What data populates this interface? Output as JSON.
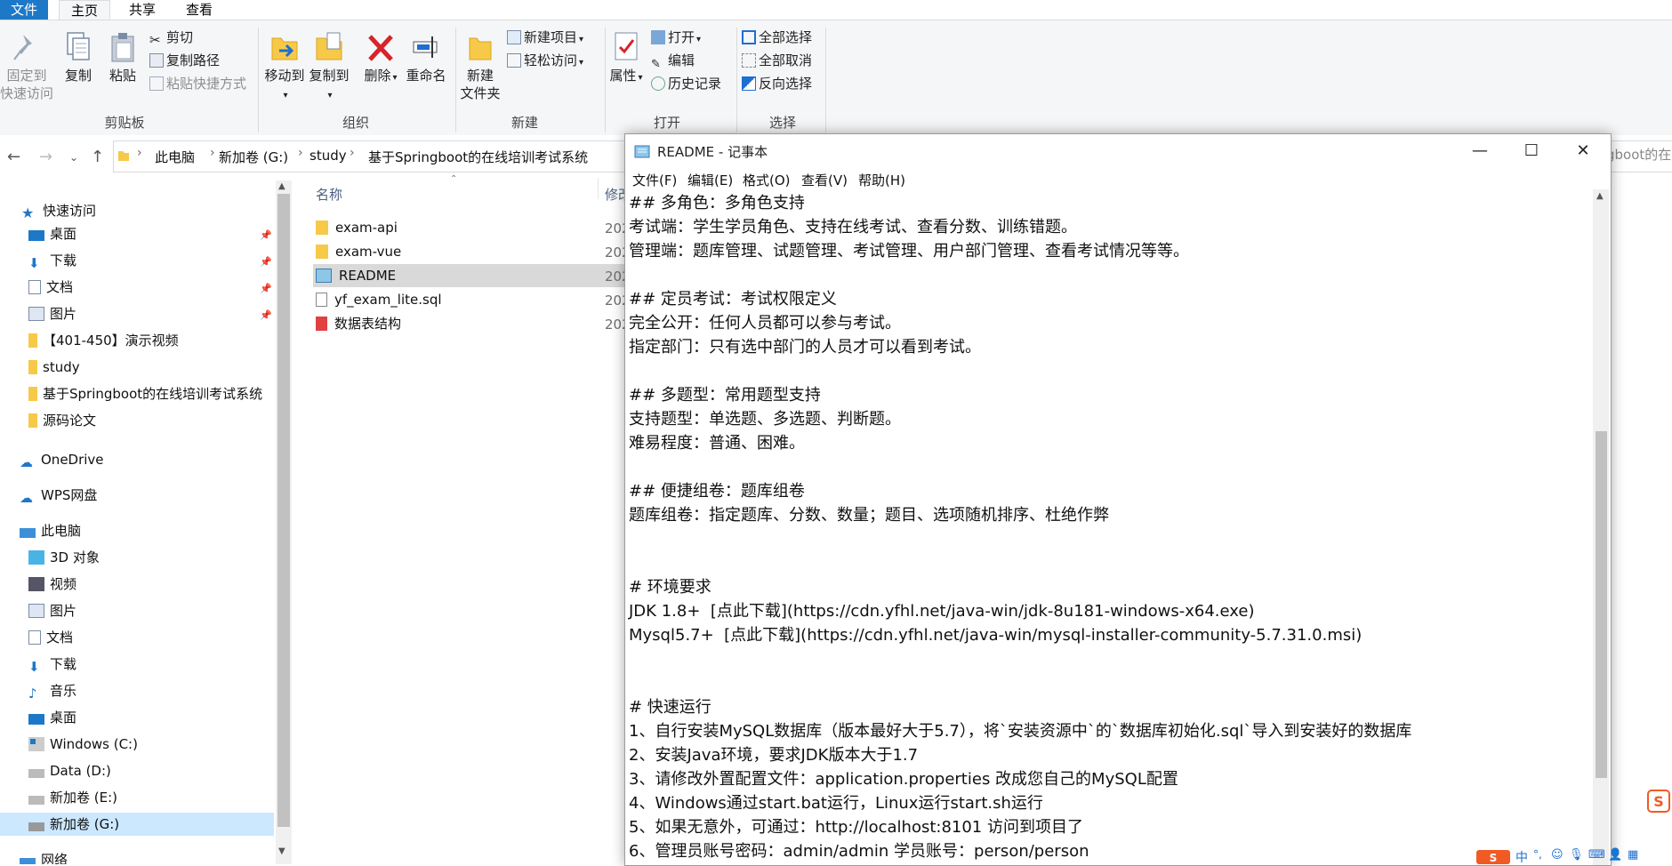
{
  "ribbon_tabs": {
    "file": "文件",
    "home": "主页",
    "share": "共享",
    "view": "查看"
  },
  "ribbon": {
    "pin_line1": "固定到",
    "pin_line2": "快速访问",
    "copy": "复制",
    "paste": "粘贴",
    "cut": "剪切",
    "copy_path": "复制路径",
    "paste_shortcut": "粘贴快捷方式",
    "group_clipboard": "剪贴板",
    "move_to": "移动到",
    "copy_to": "复制到",
    "delete": "删除",
    "rename": "重命名",
    "group_organize": "组织",
    "new_folder_line1": "新建",
    "new_folder_line2": "文件夹",
    "new_item": "新建项目",
    "easy_access": "轻松访问",
    "group_new": "新建",
    "properties": "属性",
    "open": "打开",
    "edit": "编辑",
    "history": "历史记录",
    "group_open": "打开",
    "select_all": "全部选择",
    "select_none": "全部取消",
    "invert_selection": "反向选择",
    "group_select": "选择"
  },
  "address": {
    "crumbs": [
      "此电脑",
      "新加卷 (G:)",
      "study",
      "基于Springboot的在线培训考试系统"
    ],
    "right_fragment": "gboot的在"
  },
  "nav": {
    "quick_access": "快速访问",
    "qa_items": [
      "桌面",
      "下载",
      "文档",
      "图片",
      "【401-450】演示视频",
      "study",
      "基于Springboot的在线培训考试系统",
      "源码论文"
    ],
    "onedrive": "OneDrive",
    "wps": "WPS网盘",
    "this_pc": "此电脑",
    "pc_items": [
      "3D 对象",
      "视频",
      "图片",
      "文档",
      "下载",
      "音乐",
      "桌面",
      "Windows (C:)",
      "Data (D:)",
      "新加卷 (E:)",
      "新加卷 (G:)"
    ],
    "network": "网络"
  },
  "filelist": {
    "col_name": "名称",
    "col_modified": "修改",
    "files": [
      "exam-api",
      "exam-vue",
      "README",
      "yf_exam_lite.sql",
      "数据表结构"
    ],
    "date_prefix": "202"
  },
  "notepad": {
    "title": "README - 记事本",
    "menu": [
      "文件(F)",
      "编辑(E)",
      "格式(O)",
      "查看(V)",
      "帮助(H)"
    ],
    "lines": [
      "## 多角色：多角色支持",
      "考试端：学生学员角色、支持在线考试、查看分数、训练错题。",
      "管理端：题库管理、试题管理、考试管理、用户部门管理、查看考试情况等等。",
      "",
      "## 定员考试：考试权限定义",
      "完全公开：任何人员都可以参与考试。",
      "指定部门：只有选中部门的人员才可以看到考试。",
      "",
      "## 多题型：常用题型支持",
      "支持题型：单选题、多选题、判断题。",
      "难易程度：普通、困难。",
      "",
      "## 便捷组卷：题库组卷",
      "题库组卷：指定题库、分数、数量；题目、选项随机排序、杜绝作弊",
      "",
      "",
      "# 环境要求",
      "JDK 1.8+  [点此下载](https://cdn.yfhl.net/java-win/jdk-8u181-windows-x64.exe)",
      "Mysql5.7+  [点此下载](https://cdn.yfhl.net/java-win/mysql-installer-community-5.7.31.0.msi)",
      "",
      "",
      "# 快速运行",
      "1、自行安装MySQL数据库（版本最好大于5.7），将`安装资源中`的`数据库初始化.sql`导入到安装好的数据库",
      "2、安装Java环境，要求JDK版本大于1.7",
      "3、请修改外置配置文件：application.properties 改成您自己的MySQL配置",
      "4、Windows通过start.bat运行，Linux运行start.sh运行",
      "5、如果无意外，可通过：http://localhost:8101 访问到项目了",
      "6、管理员账号密码：admin/admin 学员账号：person/person"
    ]
  },
  "tray": {
    "ime": "中"
  }
}
